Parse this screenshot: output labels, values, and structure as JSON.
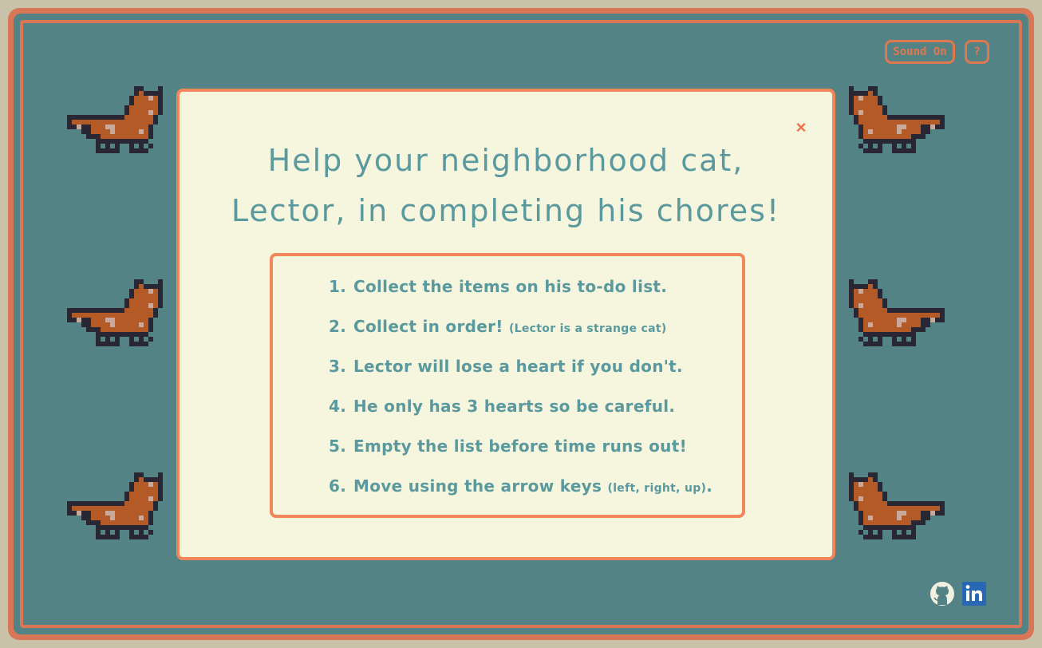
{
  "controls": {
    "sound_label": "Sound On",
    "help_label": "?"
  },
  "modal": {
    "close_label": "×",
    "title_line1": "Help your neighborhood cat,",
    "title_line2": "Lector, in completing his chores!",
    "rules": [
      {
        "num": "1.",
        "text": "Collect the items on his to-do list.",
        "note": "",
        "tail": ""
      },
      {
        "num": "2.",
        "text": "Collect in order!",
        "note": "(Lector is a strange cat)",
        "tail": ""
      },
      {
        "num": "3.",
        "text": "Lector will lose a heart if you don't.",
        "note": "",
        "tail": ""
      },
      {
        "num": "4.",
        "text": "He only has 3 hearts so be careful.",
        "note": "",
        "tail": ""
      },
      {
        "num": "5.",
        "text": "Empty the list before time runs out!",
        "note": "",
        "tail": ""
      },
      {
        "num": "6.",
        "text": "Move using the arrow keys",
        "note": "(left, right, up)",
        "tail": "."
      }
    ]
  },
  "social": {
    "github_icon": "github-icon",
    "linkedin_icon": "linkedin-icon"
  },
  "colors": {
    "background": "#548385",
    "frame": "#d87656",
    "accent": "#f0865a",
    "modal_bg": "#f6f5dd",
    "text": "#5a9a9f",
    "cat_fur": "#b35a26",
    "cat_outline": "#2a2735"
  }
}
